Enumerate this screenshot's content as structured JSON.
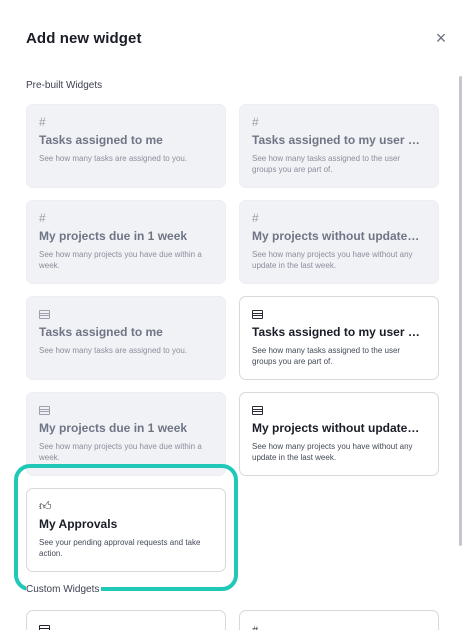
{
  "dialog": {
    "title": "Add new widget",
    "close_icon": "close-icon"
  },
  "sections": {
    "prebuilt_label": "Pre-built Widgets",
    "custom_label": "Custom Widgets"
  },
  "colors": {
    "highlight": "#20c9b7",
    "disabled_card_bg": "#f1f2f5"
  },
  "widgets": [
    {
      "icon": "hash-icon",
      "glyph": "#",
      "title": "Tasks assigned to me",
      "description": "See how many tasks are assigned to you.",
      "state": "disabled"
    },
    {
      "icon": "hash-icon",
      "glyph": "#",
      "title": "Tasks assigned to my user groups",
      "description": "See how many tasks assigned to the user groups you are part of.",
      "state": "disabled"
    },
    {
      "icon": "hash-icon",
      "glyph": "#",
      "title": "My projects due in 1 week",
      "description": "See how many projects you have due within a week.",
      "state": "disabled"
    },
    {
      "icon": "hash-icon",
      "glyph": "#",
      "title": "My projects without updates sin...",
      "description": "See how many projects you have without any update in the last week.",
      "state": "disabled"
    },
    {
      "icon": "list-icon",
      "glyph": "",
      "title": "Tasks assigned to me",
      "description": "See how many tasks are assigned to you.",
      "state": "disabled"
    },
    {
      "icon": "list-icon",
      "glyph": "",
      "title": "Tasks assigned to my user groups",
      "description": "See how many tasks assigned to the user groups you are part of.",
      "state": "enabled"
    },
    {
      "icon": "list-icon",
      "glyph": "",
      "title": "My projects due in 1 week",
      "description": "See how many projects you have due within a week.",
      "state": "disabled"
    },
    {
      "icon": "list-icon",
      "glyph": "",
      "title": "My projects without updates sin...",
      "description": "See how many projects you have without any update in the last week.",
      "state": "enabled"
    },
    {
      "icon": "thumbs-up-icon",
      "glyph": "👍︎",
      "title": "My Approvals",
      "description": "See your pending approval requests and take action.",
      "state": "enabled"
    }
  ],
  "custom_widgets_partial": [
    {
      "icon": "list-icon",
      "glyph": ""
    },
    {
      "icon": "hash-icon",
      "glyph": "#"
    }
  ]
}
